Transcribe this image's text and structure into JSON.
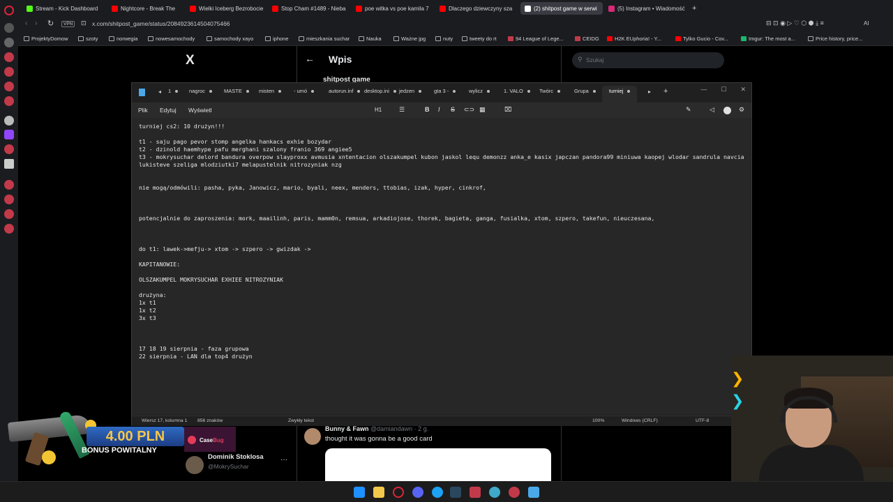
{
  "browser": {
    "tabs": [
      {
        "label": "Stream - Kick Dashboard",
        "color": "#53fc18"
      },
      {
        "label": "Nightcore - Break The",
        "color": "#ff0000"
      },
      {
        "label": "Wielki Iceberg Bezrobocie",
        "color": "#ff0000"
      },
      {
        "label": "Stop Cham #1489 - Nieba",
        "color": "#ff0000"
      },
      {
        "label": "poe witka vs poe kamila 7",
        "color": "#ff0000"
      },
      {
        "label": "Dlaczego dziewczyny sza",
        "color": "#ff0000"
      },
      {
        "label": "(2) shitpost game w serwi",
        "color": "#ffffff"
      },
      {
        "label": "(5) Instagram • Wiadomość",
        "color": "#d62976"
      }
    ],
    "new_tab": "+",
    "vpn": "VPN",
    "url": "x.com/shitpost_game/status/2084923614504075466",
    "ai_label": "AI",
    "bookmarks": [
      "ProjektyDomow",
      "szoty",
      "norwegia",
      "nowesamochody",
      "samochody xayo",
      "iphone",
      "mieszkania suchar",
      "Nauka",
      "Ważne jpg",
      "nuty",
      "tweety do rt",
      "94 League of Lege...",
      "CEIDG",
      "H2K EUphoria! - Y...",
      "Tylko Gucio - Cov...",
      "Imgur: The most a...",
      "Price history, price..."
    ]
  },
  "twitter": {
    "logo": "X",
    "back_arrow": "←",
    "page_title": "Wpis",
    "author": "shitpost game",
    "search_placeholder": "Szukaj",
    "reply": {
      "name": "Bunny & Fawn",
      "handle": "@damiandawn · 2 g.",
      "text": "thought it was gonna be a good card"
    },
    "account": {
      "name": "Dominik Stoklosa",
      "handle": "@MokrySuchar",
      "more": "···"
    }
  },
  "notepad": {
    "tabs": [
      "1",
      "nagroc",
      "MASTE",
      "misten",
      "- umó",
      "autorun.inf",
      "desktop.ini",
      "jedzen",
      "gta 3 -",
      "wylicz",
      "1. VALO",
      "Twórc",
      "Grupa",
      "turniej"
    ],
    "active_tab": "turniej",
    "new_tab": "+",
    "menu": {
      "file": "Plik",
      "edit": "Edytuj",
      "view": "Wyświetl"
    },
    "heading": "H1",
    "lines": [
      "turniej cs2: 10 drużyn!!!",
      "",
      "t1 - saju pago pevor stomp angelka hankacs exhie bozydar",
      "t2 - dzinold haemhype pafu merghani szalony franio 369 angiee5",
      "t3 - mokrysuchar delord bandura overpow slayproxx avmusia xntentacion olszakumpel kubon jaskol lequ demonzz anka_e kasix japczan pandora99 miniuwa kaopej wlodar sandrula navcia",
      "lukisteve szeliga mlodziutki7 melapustelnik nitrozyniak nzg",
      "",
      "",
      "nie mogą/odmówili: pasha, pyka, Janowicz, mario, byali, neex, menders, ttobias, izak, hyper, cinkrof,",
      "",
      "",
      "",
      "potencjalnie do zaproszenia: mork, maailinh, paris, mamm0n, remsua, arkadiojose, thorek, bagieta, ganga, fusialka, xtom, szpero, takefun, nieuczesana,",
      "",
      "",
      "",
      "do t1: lawek->mefju-> xtom -> szpero -> gwizdak ->",
      "",
      "KAPITANOWIE:",
      "",
      "OLSZAKUMPEL MOKRYSUCHAR EXHIEE NITROZYNIAK",
      "",
      "drużyna:",
      "1x t1",
      "1x t2",
      "3x t3",
      "",
      "",
      "",
      "17 18 19 sierpnia - faza grupowa",
      "22 sierpnia - LAN dla top4 drużyn"
    ],
    "status": {
      "position": "Wiersz 17, kolumna 1",
      "chars": "856 znaków",
      "format": "Zwykły tekst",
      "zoom": "100%",
      "line_endings": "Windows (CRLF)",
      "encoding": "UTF-8"
    }
  },
  "ad": {
    "amount": "4.00 PLN",
    "bonus": "BONUS POWITALNY",
    "brand_a": "Case",
    "brand_b": "Bug"
  }
}
